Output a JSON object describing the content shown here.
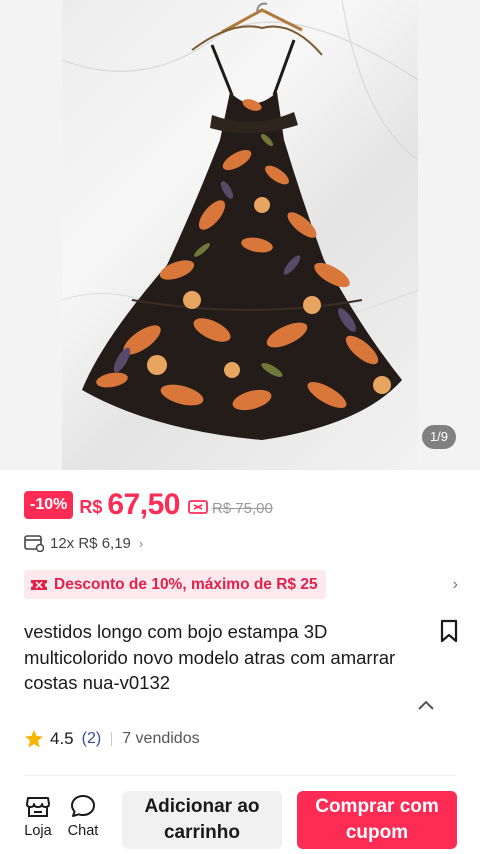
{
  "gallery": {
    "counter": "1/9",
    "image_alt": "floral-maxi-dress-photo"
  },
  "price": {
    "discount_badge": "-10%",
    "currency": "R$",
    "current": "67,50",
    "original": "R$ 75,00"
  },
  "installments": {
    "text": "12x R$ 6,19",
    "chevron": "›"
  },
  "promo": {
    "text": "Desconto de 10%, máximo de R$ 25",
    "chevron": "›"
  },
  "product": {
    "title": "vestidos longo com bojo estampa 3D multicolorido novo modelo atras com amarrar costas nua-v0132"
  },
  "rating": {
    "score": "4.5",
    "reviews": "(2)",
    "sold": "7 vendidos"
  },
  "bottom_bar": {
    "store_label": "Loja",
    "chat_label": "Chat",
    "cart_label": "Adicionar ao carrinho",
    "buy_label": "Comprar com cupom"
  },
  "colors": {
    "accent": "#fe2c55",
    "promo_bg": "#fde8ee",
    "promo_text": "#e1224b",
    "rating_star": "#f7b500"
  },
  "icons": [
    "coupon-icon",
    "card-icon",
    "promo-icon",
    "bookmark-icon",
    "chevron-up-icon",
    "star-icon",
    "store-icon",
    "chat-icon"
  ]
}
